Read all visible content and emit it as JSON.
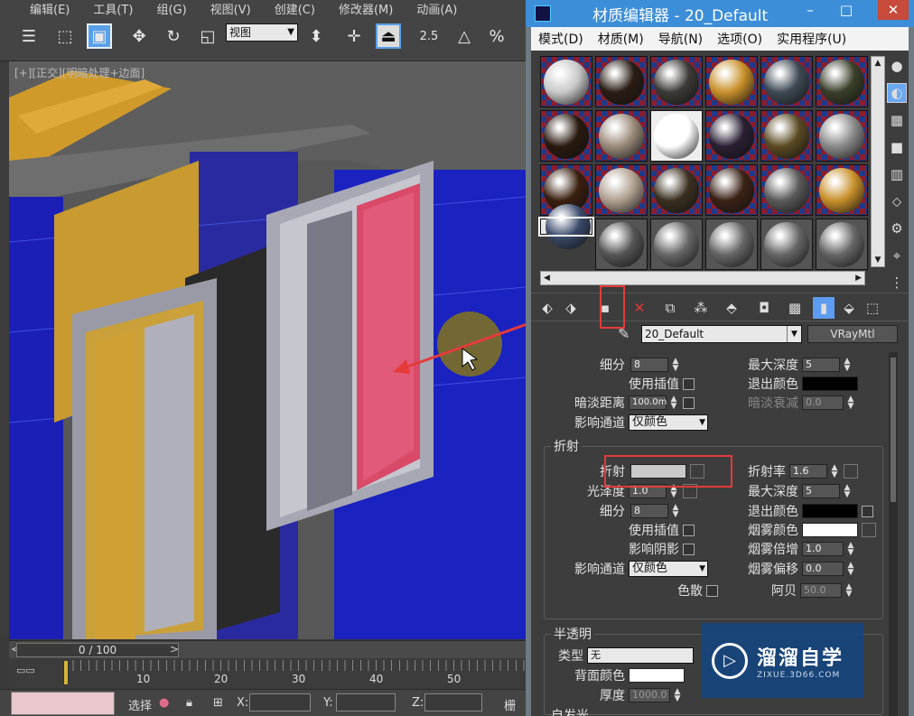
{
  "main": {
    "menu": [
      "编辑(E)",
      "工具(T)",
      "组(G)",
      "视图(V)",
      "创建(C)",
      "修改器(M)",
      "动画(A)"
    ],
    "view_dropdown": "视图",
    "snap_label": "2.5",
    "percent_snap_label": "%",
    "viewport_label": "[+][正交][明暗处理+边面]",
    "timeline": {
      "frame_display": "0 / 100",
      "prev": "<",
      "next": ">",
      "ticks": [
        "10",
        "20",
        "30",
        "40",
        "50"
      ]
    },
    "status": {
      "select_label": "选择",
      "x_label": "X:",
      "y_label": "Y:",
      "z_label": "Z:",
      "grid_label": "栅格"
    }
  },
  "material_editor": {
    "title": "材质编辑器 - 20_Default",
    "window_buttons": {
      "minimize": "–",
      "maximize": "□",
      "close": "✕"
    },
    "menu": [
      "模式(D)",
      "材质(M)",
      "导航(N)",
      "选项(O)",
      "实用程序(U)"
    ],
    "material_name": "20_Default",
    "material_type": "VRayMtl",
    "slot_colors": [
      "#c8c8c8",
      "#2a1d14",
      "#3c3a36",
      "#c8902a",
      "#3e4a55",
      "#3a3f2a",
      "#2a1a10",
      "#9a8a7a",
      "#ffffff",
      "#2a1f33",
      "#5a4a22",
      "#8a8a8a",
      "#3a2010",
      "#b0a090",
      "#3a3020",
      "#3a2215",
      "#5a5a5a",
      "#c8902a",
      "#3a4a6a",
      "#555555",
      "#666666",
      "#666666",
      "#666666",
      "#666666"
    ],
    "reflection": {
      "subdivs_label": "细分",
      "subdivs_value": "8",
      "max_depth_label": "最大深度",
      "max_depth_value": "5",
      "use_interp_label": "使用插值",
      "exit_color_label": "退出颜色",
      "dim_distance_label": "暗淡距离",
      "dim_distance_value": "100.0m",
      "dim_falloff_label": "暗淡衰减",
      "dim_falloff_value": "0.0",
      "affect_channels_label": "影响通道",
      "affect_channels_value": "仅颜色"
    },
    "refraction": {
      "group_title": "折射",
      "refract_label": "折射",
      "ior_label": "折射率",
      "ior_value": "1.6",
      "glossiness_label": "光泽度",
      "glossiness_value": "1.0",
      "max_depth_label": "最大深度",
      "max_depth_value": "5",
      "subdivs_label": "细分",
      "subdivs_value": "8",
      "exit_color_label": "退出颜色",
      "use_interp_label": "使用插值",
      "fog_color_label": "烟雾颜色",
      "affect_shadows_label": "影响阴影",
      "fog_multiplier_label": "烟雾倍增",
      "fog_multiplier_value": "1.0",
      "affect_channels_label": "影响通道",
      "affect_channels_value": "仅颜色",
      "fog_bias_label": "烟雾偏移",
      "fog_bias_value": "0.0",
      "dispersion_label": "色散",
      "abbe_label": "阿贝",
      "abbe_value": "50.0"
    },
    "translucency": {
      "group_title": "半透明",
      "type_label": "类型",
      "type_value": "无",
      "back_color_label": "背面颜色",
      "thickness_label": "厚度",
      "thickness_value": "1000.0",
      "next_group_label": "自发光"
    }
  },
  "watermark": {
    "title": "溜溜自学",
    "url": "ZIXUE.3D66.COM"
  },
  "colors": {
    "accent_blue": "#3c8ed8",
    "annotation_red": "#e43a3a",
    "refract_swatch": "#c9c9c9",
    "exit_color": "#000000",
    "fog_color": "#ffffff"
  }
}
